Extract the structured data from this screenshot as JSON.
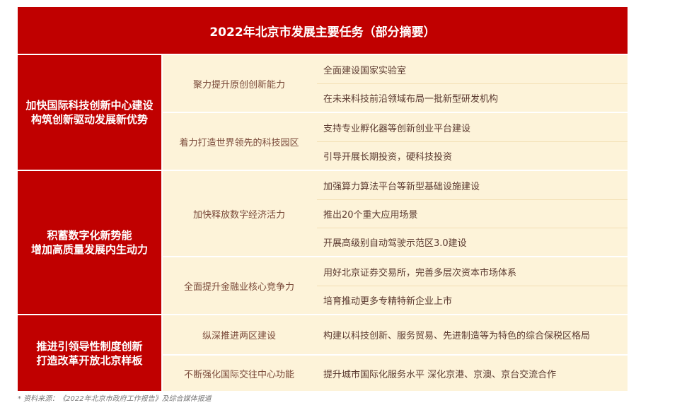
{
  "title": "2022年北京市发展主要任务（部分摘要）",
  "sections": [
    {
      "label_lines": [
        "加快国际科技创新中心建设",
        "构筑创新驱动发展新优势"
      ],
      "subs": [
        {
          "label": "聚力提升原创创新能力",
          "items": [
            "全面建设国家实验室",
            "在未来科技前沿领域布局一批新型研发机构"
          ]
        },
        {
          "label": "着力打造世界领先的科技园区",
          "items": [
            "支持专业孵化器等创新创业平台建设",
            "引导开展长期投资，硬科技投资"
          ]
        }
      ]
    },
    {
      "label_lines": [
        "积蓄数字化新势能",
        "增加高质量发展内生动力"
      ],
      "subs": [
        {
          "label": "加快释放数字经济活力",
          "items": [
            "加强算力算法平台等新型基础设施建设",
            "推出20个重大应用场景",
            "开展高级别自动驾驶示范区3.0建设"
          ]
        },
        {
          "label": "全面提升金融业核心竞争力",
          "items": [
            "用好北京证券交易所，完善多层次资本市场体系",
            "培育推动更多专精特新企业上市"
          ]
        }
      ]
    },
    {
      "label_lines": [
        "推进引领导性制度创新",
        "打造改革开放北京样板"
      ],
      "subs": [
        {
          "label": "纵深推进两区建设",
          "items": [
            "构建以科技创新、服务贸易、先进制造等为特色的综合保税区格局"
          ]
        },
        {
          "label": "不断强化国际交往中心功能",
          "items": [
            "提升城市国际化服务水平  深化京港、京澳、京台交流合作"
          ]
        }
      ]
    }
  ],
  "source": "* 资料来源：《2022年北京市政府工作报告》及综合媒体报道"
}
